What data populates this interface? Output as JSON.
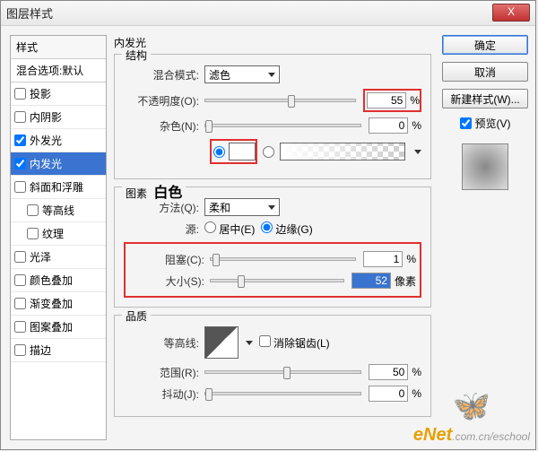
{
  "window": {
    "title": "图层样式"
  },
  "sidebar": {
    "header": "样式",
    "blend": "混合选项:默认",
    "items": [
      {
        "label": "投影",
        "checked": false
      },
      {
        "label": "内阴影",
        "checked": false
      },
      {
        "label": "外发光",
        "checked": true
      },
      {
        "label": "内发光",
        "checked": true,
        "selected": true
      },
      {
        "label": "斜面和浮雕",
        "checked": false
      },
      {
        "label": "等高线",
        "checked": false,
        "indent": true
      },
      {
        "label": "纹理",
        "checked": false,
        "indent": true
      },
      {
        "label": "光泽",
        "checked": false
      },
      {
        "label": "颜色叠加",
        "checked": false
      },
      {
        "label": "渐变叠加",
        "checked": false
      },
      {
        "label": "图案叠加",
        "checked": false
      },
      {
        "label": "描边",
        "checked": false
      }
    ]
  },
  "panel": {
    "title": "内发光",
    "structure": {
      "title": "结构",
      "blend_mode_label": "混合模式:",
      "blend_mode_value": "滤色",
      "opacity_label": "不透明度(O):",
      "opacity_value": "55",
      "opacity_unit": "%",
      "noise_label": "杂色(N):",
      "noise_value": "0",
      "noise_unit": "%"
    },
    "elements": {
      "title": "图素",
      "title_suffix": "白色",
      "method_label": "方法(Q):",
      "method_value": "柔和",
      "source_label": "源:",
      "source_center": "居中(E)",
      "source_edge": "边缘(G)",
      "choke_label": "阻塞(C):",
      "choke_value": "1",
      "choke_unit": "%",
      "size_label": "大小(S):",
      "size_value": "52",
      "size_unit": "像素"
    },
    "quality": {
      "title": "品质",
      "contour_label": "等高线:",
      "anti_alias": "消除锯齿(L)",
      "range_label": "范围(R):",
      "range_value": "50",
      "range_unit": "%",
      "jitter_label": "抖动(J):",
      "jitter_value": "0",
      "jitter_unit": "%"
    }
  },
  "buttons": {
    "ok": "确定",
    "cancel": "取消",
    "new_style": "新建样式(W)...",
    "preview": "预览(V)"
  },
  "watermark": {
    "brand": "eNet",
    "suffix": ".com.cn/eschool"
  }
}
